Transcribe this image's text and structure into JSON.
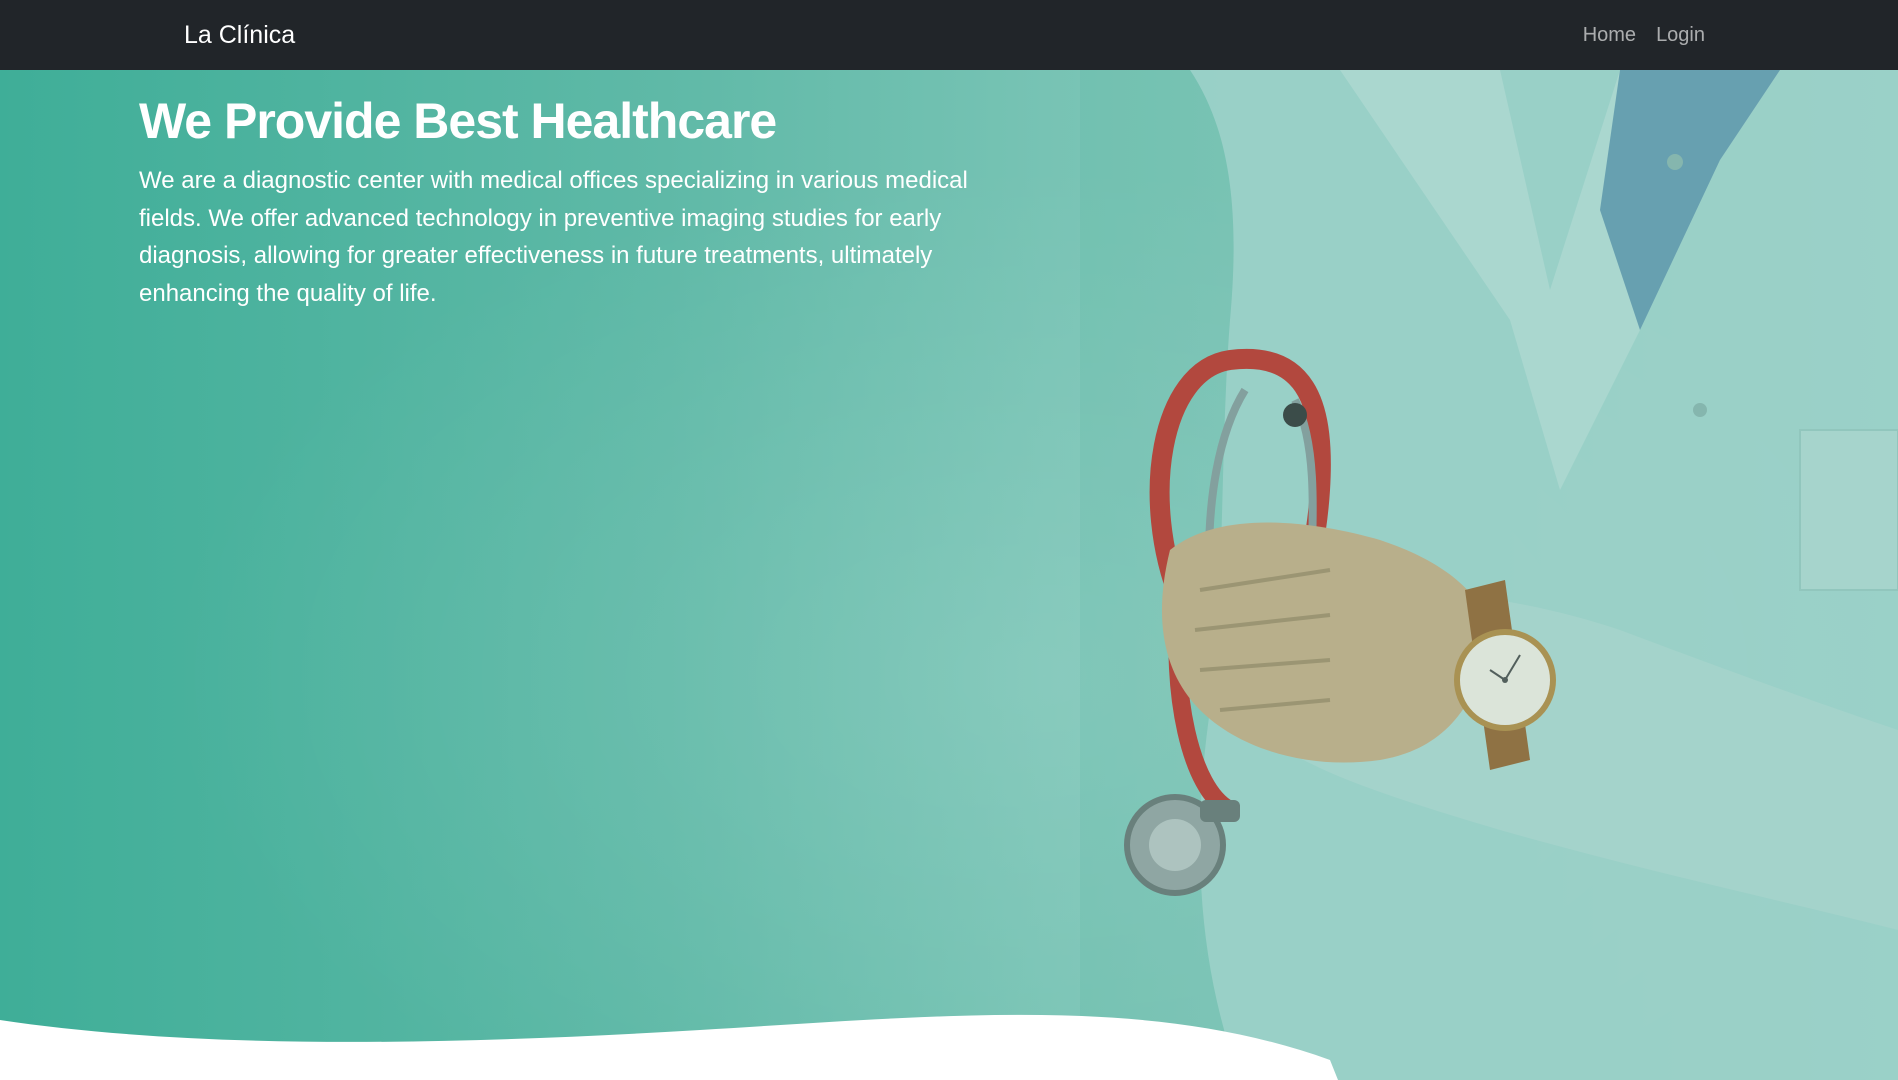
{
  "navbar": {
    "brand": "La Clínica",
    "links": [
      {
        "label": "Home"
      },
      {
        "label": "Login"
      }
    ]
  },
  "hero": {
    "title": "We Provide Best Healthcare",
    "description": "We are a diagnostic center with medical offices specializing in various medical fields. We offer advanced technology in preventive imaging studies for early diagnosis, allowing for greater effectiveness in future treatments, ultimately enhancing the quality of life."
  },
  "colors": {
    "navbar_bg": "#212529",
    "hero_teal": "#3fae98",
    "text_white": "#ffffff"
  }
}
